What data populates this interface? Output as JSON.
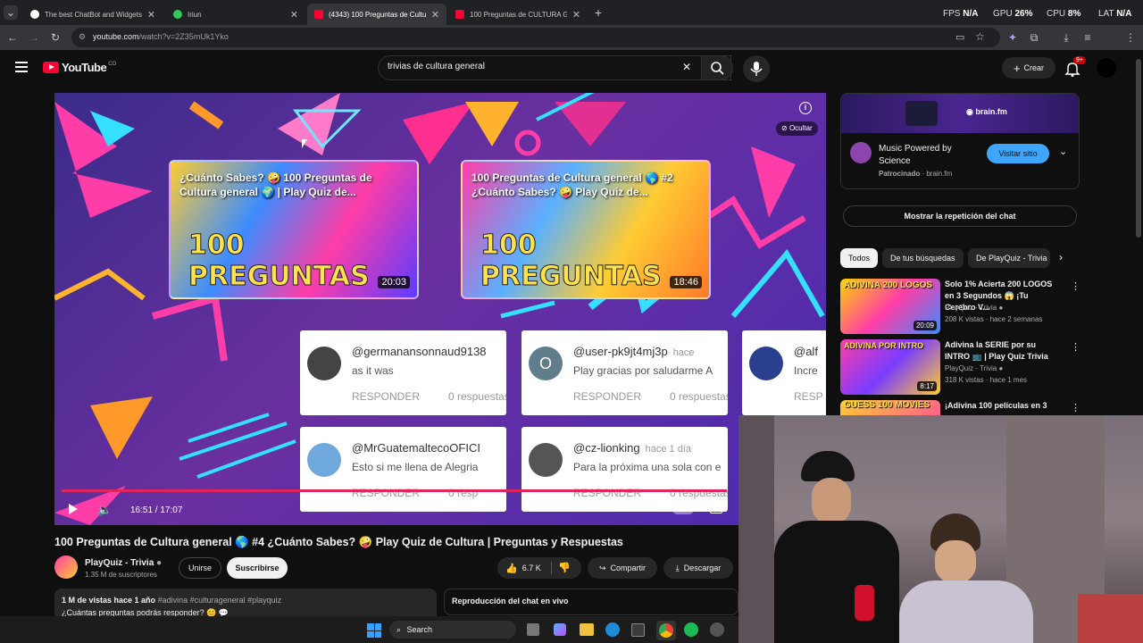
{
  "browser": {
    "tabs": [
      {
        "title": "The best ChatBot and Widgets f",
        "color": "#ffffff"
      },
      {
        "title": "Iriun",
        "color": "#34c759"
      },
      {
        "title": "(4343) 100 Preguntas de Cultura",
        "color": "#ff0033"
      },
      {
        "title": "100 Preguntas de CULTURA GE",
        "color": "#ff0033"
      }
    ],
    "url_host": "youtube.com",
    "url_path": "/watch?v=2Z35mUk1Yko",
    "perf": {
      "fps_label": "FPS",
      "fps": "N/A",
      "gpu_label": "GPU",
      "gpu": "26",
      "gpu_unit": "%",
      "cpu_label": "CPU",
      "cpu": "8",
      "cpu_unit": "%",
      "lat_label": "LAT",
      "lat": "N/A"
    }
  },
  "youtube": {
    "logo": "YouTube",
    "country": "CO",
    "search_value": "trivias de cultura general",
    "create_label": "Crear",
    "notif_count": "9+"
  },
  "video": {
    "hide_label": "Ocultar",
    "thumbs": [
      {
        "title": "¿Cuánto Sabes? 🤪 100 Preguntas de Cultura general 🌍 | Play Quiz de...",
        "big": "100 PREGUNTAS",
        "duration": "20:03"
      },
      {
        "title": "100 Preguntas de Cultura general 🌎 #2 ¿Cuánto Sabes? 🤪 Play Quiz de...",
        "big": "100 PREGUNTAS",
        "duration": "18:46"
      }
    ],
    "comments": [
      {
        "user": "@germanansonnaud9138",
        "ago": "",
        "text": "as it was",
        "reply": "RESPONDER",
        "replies": "0 respuestas"
      },
      {
        "user": "@user-pk9jt4mj3p",
        "ago": "hace",
        "text": "Play gracias por saludarme A",
        "reply": "RESPONDER",
        "replies": "0 respuestas"
      },
      {
        "user": "@alf",
        "ago": "",
        "text": "Incre",
        "reply": "RESP",
        "replies": ""
      },
      {
        "user": "@MrGuatemaltecoOFICI",
        "ago": "",
        "text": "Esto si me llena de Alegria",
        "reply": "RESPONDER",
        "replies": "0 resp"
      },
      {
        "user": "@cz-lionking",
        "ago": "hace 1 día",
        "text": "Para la próxima una sola con e",
        "reply": "RESPONDER",
        "replies": "0 respuestas"
      }
    ],
    "time": "16:51 / 17:07",
    "progress": 0.985,
    "title": "100 Preguntas de Cultura general 🌎 #4 ¿Cuánto Sabes? 🤪 Play Quiz de Cultura | Preguntas y Respuestas",
    "channel": "PlayQuiz - Trivia",
    "subscribers": "1.35 M de suscriptores",
    "join_label": "Unirse",
    "subscribe_label": "Suscribirse",
    "likes": "6.7 K",
    "share_label": "Compartir",
    "download_label": "Descargar",
    "views": "1 M de vistas  hace 1 año",
    "hashtags": "#adivina #culturageneral #playquiz",
    "desc_line": "¿Cuántas preguntas podrás responder? 😊 💬",
    "chat_replay": "Reproducción del chat en vivo"
  },
  "sidebar": {
    "ad": {
      "brand": "brain.fm",
      "title": "Music Powered by Science",
      "sponsored": "Patrocinado",
      "domain": "brain.fm",
      "cta": "Visitar sitio"
    },
    "chat_button": "Mostrar la repetición del chat",
    "chips": [
      "Todos",
      "De tus búsquedas",
      "De PlayQuiz - Trivia"
    ],
    "recs": [
      {
        "title": "Solo 1% Acierta 200 LOGOS en 3 Segundos 😱 ¡Tu Cerebro V...",
        "channel": "PlayQuiz - Trivia",
        "meta": "208 K vistas · hace 2 semanas",
        "duration": "20:09",
        "thumb_text": "ADIVINA 200 LOGOS"
      },
      {
        "title": "Adivina la SERIE por su INTRO 📺 | Play Quiz Trivia",
        "channel": "PlayQuiz - Trivia",
        "meta": "318 K vistas · hace 1 mes",
        "duration": "8:17",
        "thumb_text": "ADIVINA POR INTRO"
      },
      {
        "title": "¡Adivina 100 películas en 3",
        "channel": "",
        "meta": "",
        "duration": "",
        "thumb_text": "GUESS 100 MOVIES"
      }
    ]
  },
  "taskbar": {
    "search": "Search"
  }
}
